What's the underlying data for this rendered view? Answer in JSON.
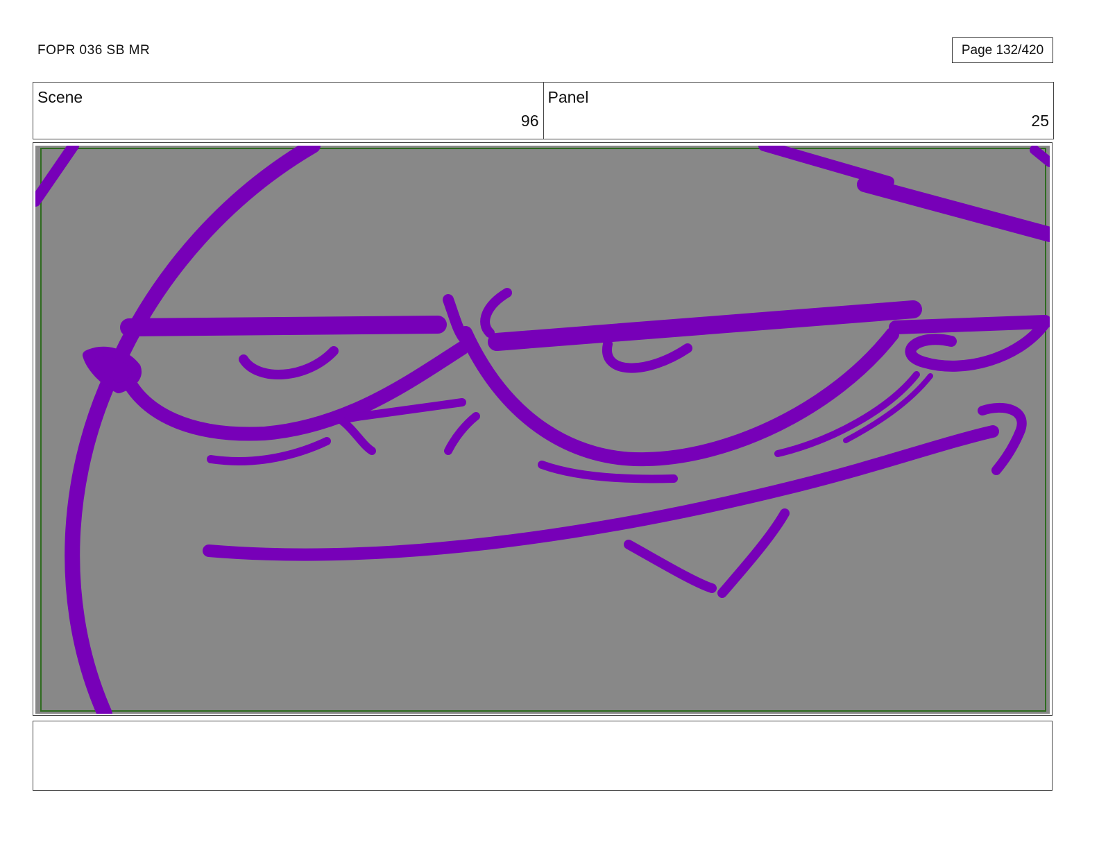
{
  "header": {
    "doc_title": "FOPR 036 SB MR",
    "page_label": "Page 132/420"
  },
  "scene": {
    "label": "Scene",
    "value": "96"
  },
  "panel": {
    "label": "Panel",
    "value": "25"
  },
  "colors": {
    "sketch_stroke": "#7700b8",
    "panel_background": "#888888",
    "safe_frame": "#2e6b1f"
  },
  "notes": {
    "text": ""
  }
}
